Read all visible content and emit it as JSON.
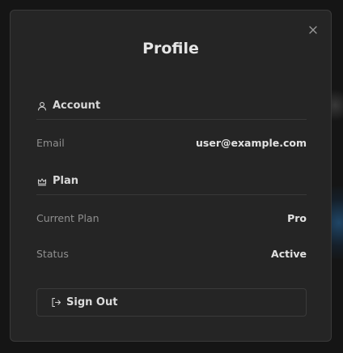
{
  "dialog": {
    "title": "Profile",
    "close_icon": "close-icon"
  },
  "account": {
    "heading": "Account",
    "icon": "user-icon",
    "email_label": "Email",
    "email_value": "user@example.com"
  },
  "plan": {
    "heading": "Plan",
    "icon": "crown-icon",
    "current_plan_label": "Current Plan",
    "current_plan_value": "Pro",
    "status_label": "Status",
    "status_value": "Active"
  },
  "actions": {
    "sign_out_label": "Sign Out",
    "sign_out_icon": "sign-out-icon"
  },
  "colors": {
    "dialog_bg": "#252525",
    "border": "#3a3a3a",
    "text_primary": "#e2e2e2",
    "text_muted": "#8f8f8f"
  }
}
